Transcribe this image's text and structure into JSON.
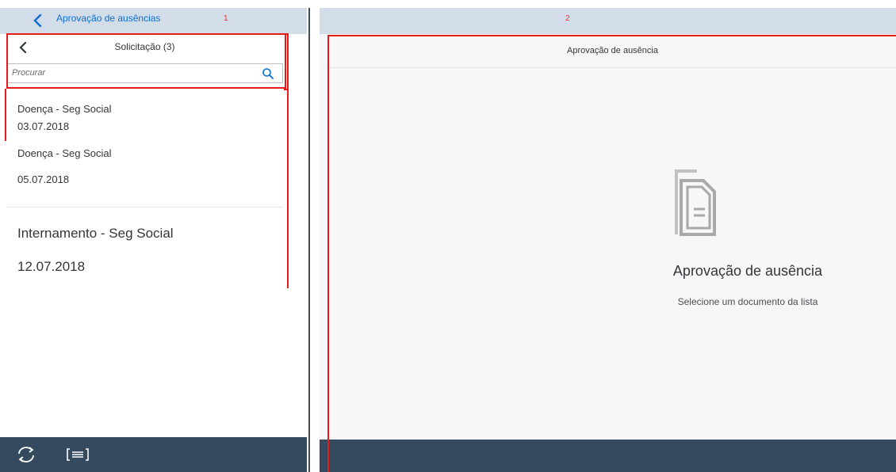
{
  "left_panel": {
    "header": {
      "title": "Aprovação de ausências",
      "marker": "1"
    },
    "subheader": {
      "title": "Solicitação (3)"
    },
    "search": {
      "placeholder": "Procurar"
    },
    "items": [
      {
        "name": "Doença - Seg Social",
        "date": "03.07.2018"
      },
      {
        "name": "Doença - Seg Social",
        "date": "05.07.2018"
      },
      {
        "name": "Internamento - Seg Social",
        "date": "12.07.2018"
      }
    ]
  },
  "right_panel": {
    "marker": "2",
    "header": {
      "title": "Aprovação de ausência"
    },
    "empty_state": {
      "title": "Aprovação de ausência",
      "subtitle": "Selecione um documento da lista",
      "icon": "document-icon"
    }
  },
  "colors": {
    "header_bg": "#d3dde9",
    "footer_bg": "#354a5f",
    "accent": "#0a6ed1",
    "highlight_border": "#e81b1b"
  }
}
